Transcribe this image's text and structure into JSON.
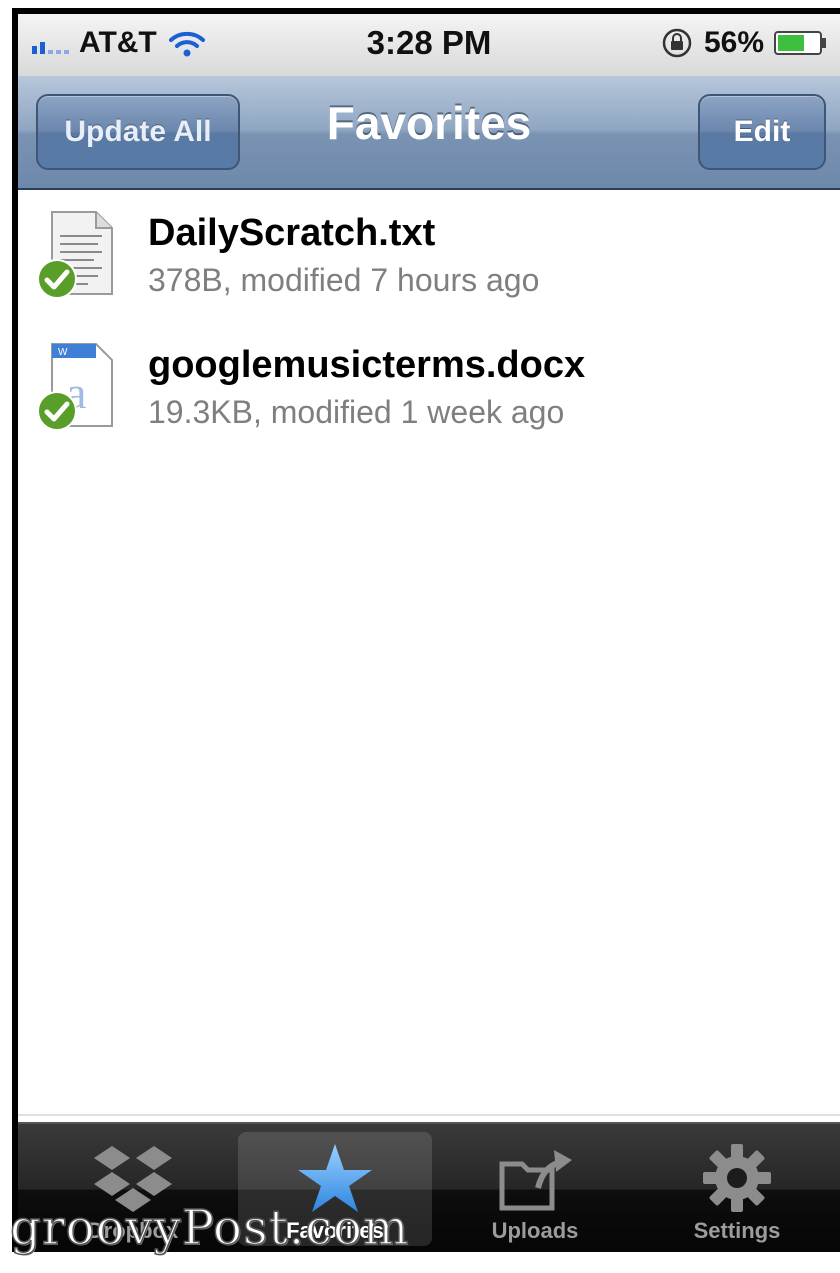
{
  "status_bar": {
    "carrier": "AT&T",
    "time": "3:28 PM",
    "battery": "56%",
    "icons": [
      "signal-icon",
      "wifi-icon",
      "rotation-lock-icon",
      "battery-icon"
    ]
  },
  "nav": {
    "left_button": "Update All",
    "title": "Favorites",
    "right_button": "Edit"
  },
  "files": [
    {
      "name": "DailyScratch.txt",
      "meta": "378B, modified 7 hours ago",
      "icon": "text-file-icon",
      "status_icon": "checkmark-icon"
    },
    {
      "name": "googlemusicterms.docx",
      "meta": "19.3KB, modified 1 week ago",
      "icon": "word-doc-icon",
      "status_icon": "checkmark-icon"
    }
  ],
  "tabs": [
    {
      "label": "Dropbox",
      "icon": "dropbox-icon",
      "selected": false
    },
    {
      "label": "Favorites",
      "icon": "star-icon",
      "selected": true
    },
    {
      "label": "Uploads",
      "icon": "upload-folder-icon",
      "selected": false
    },
    {
      "label": "Settings",
      "icon": "gear-icon",
      "selected": false
    }
  ],
  "watermark": "groovyPost.com",
  "colors": {
    "nav_bar": "#7a93b3",
    "tab_selected": "#4a9be8",
    "check_green": "#5a9e2a",
    "meta_text": "#7f7f7f"
  }
}
